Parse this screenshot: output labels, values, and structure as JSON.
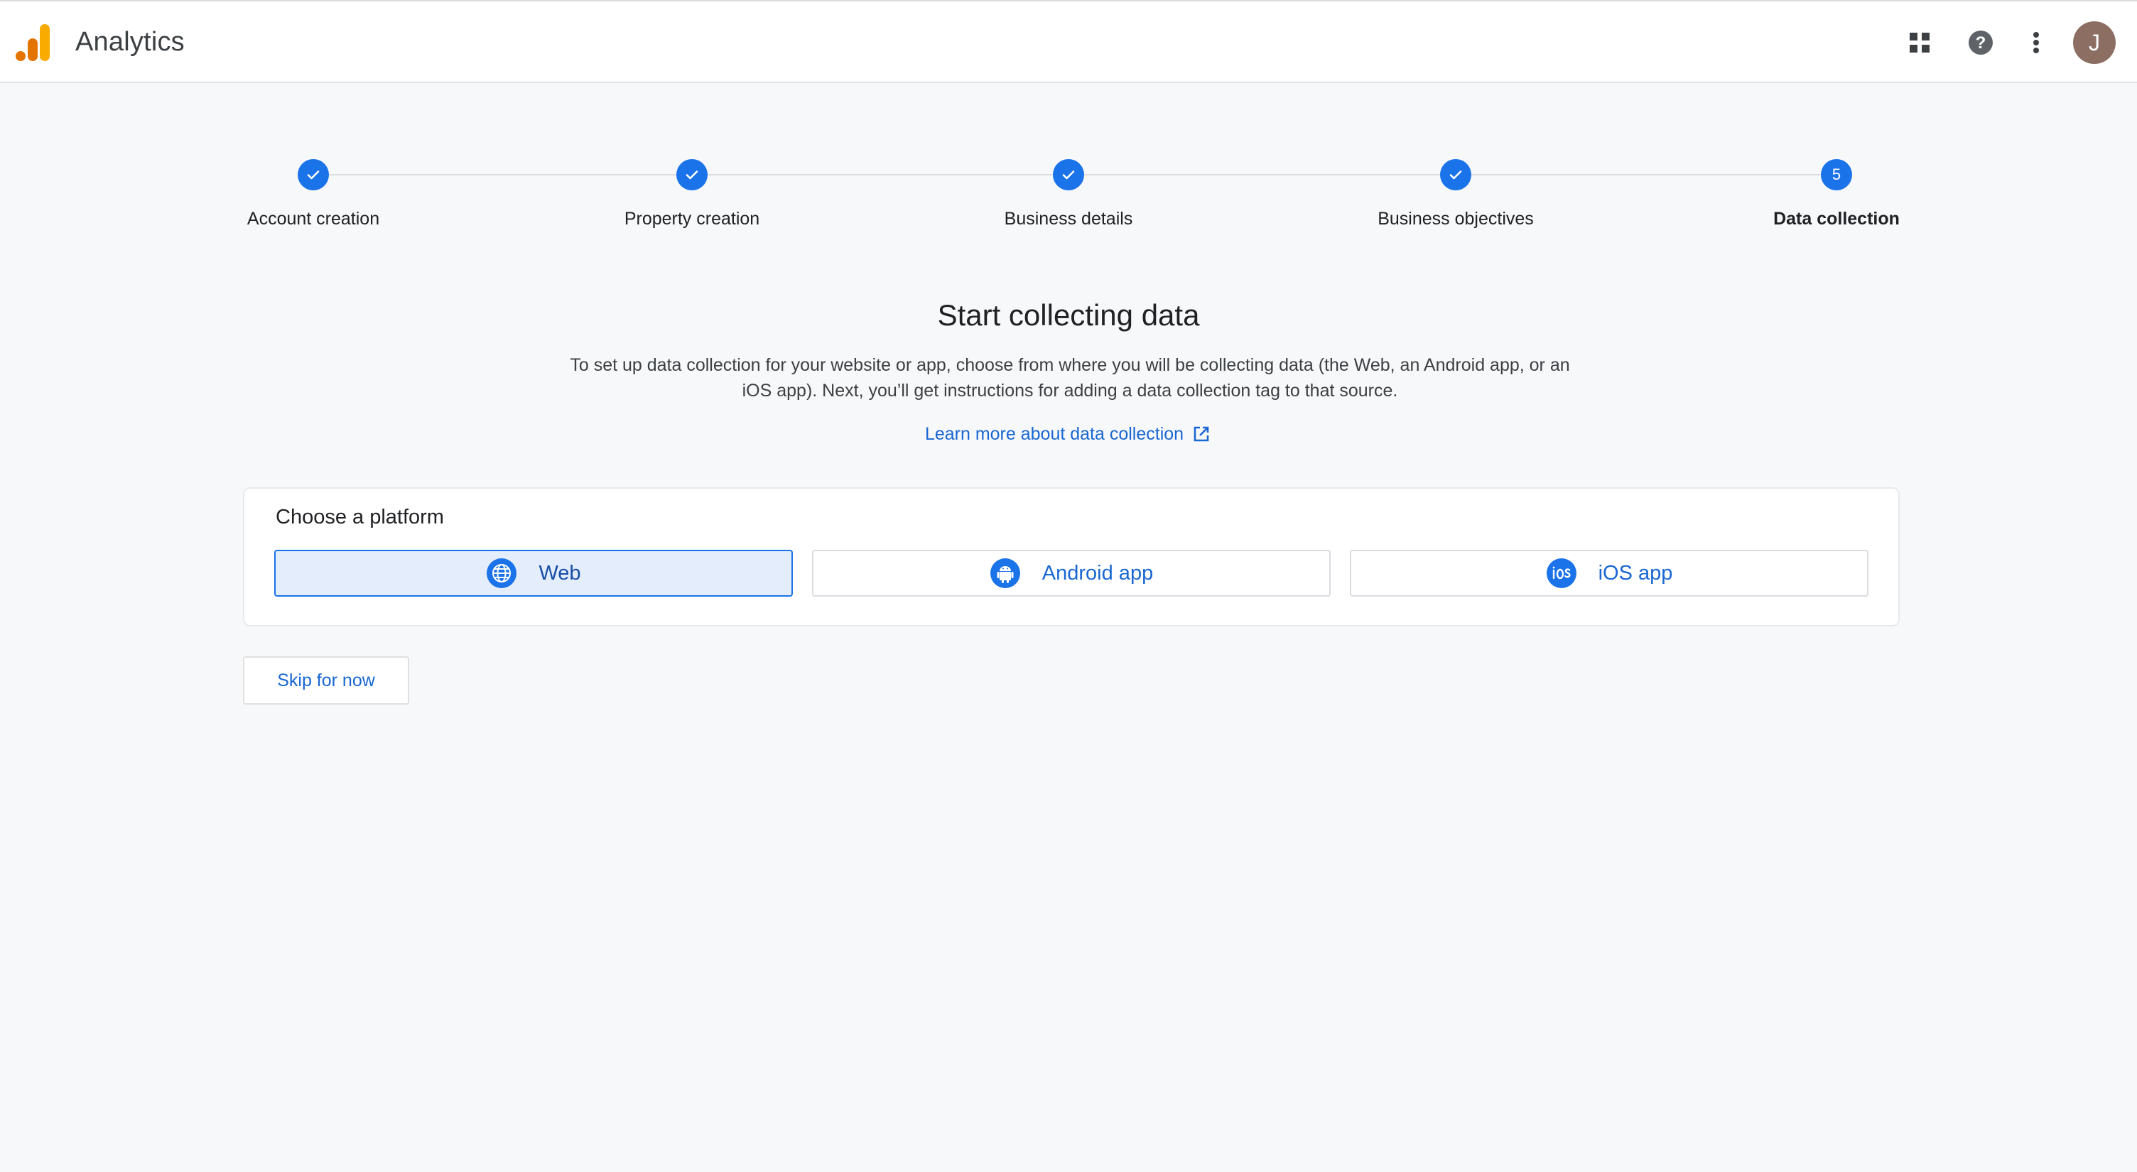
{
  "header": {
    "app_title": "Analytics",
    "icons": [
      "apps-grid-icon",
      "help-icon",
      "more-vert-icon"
    ],
    "avatar_initial": "J",
    "avatar_color": "#8d6e63"
  },
  "stepper": {
    "steps": [
      {
        "label": "Account creation",
        "status": "complete"
      },
      {
        "label": "Property creation",
        "status": "complete"
      },
      {
        "label": "Business details",
        "status": "complete"
      },
      {
        "label": "Business objectives",
        "status": "complete"
      },
      {
        "label": "Data collection",
        "status": "current",
        "number": "5"
      }
    ]
  },
  "main": {
    "heading": "Start collecting data",
    "description": "To set up data collection for your website or app, choose from where you will be collecting data (the Web, an Android app, or an iOS app). Next, you’ll get instructions for adding a data collection tag to that source.",
    "learn_more": "Learn more about data collection"
  },
  "platform": {
    "title": "Choose a platform",
    "options": [
      {
        "label": "Web",
        "icon": "globe-icon",
        "selected": true
      },
      {
        "label": "Android app",
        "icon": "android-icon",
        "selected": false
      },
      {
        "label": "iOS app",
        "icon": "ios-icon",
        "selected": false
      }
    ]
  },
  "actions": {
    "skip_label": "Skip for now"
  },
  "colors": {
    "accent": "#1a73e8",
    "link": "#1967d2",
    "selected_bg": "#e3edfc"
  }
}
